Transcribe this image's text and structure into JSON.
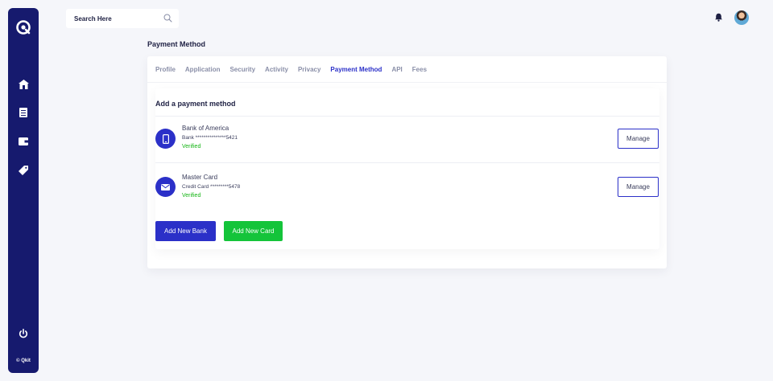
{
  "sidebar": {
    "logo": "qkit-logo-icon",
    "items": [
      {
        "icon": "home-icon"
      },
      {
        "icon": "list-icon"
      },
      {
        "icon": "wallet-icon"
      },
      {
        "icon": "tag-icon"
      }
    ],
    "power_icon": "power-icon",
    "copyright": "© Qkit"
  },
  "header": {
    "search_placeholder": "Search Here",
    "search_icon": "search-icon",
    "bell_icon": "bell-icon"
  },
  "page": {
    "title": "Payment Method",
    "tabs": [
      {
        "label": "Profile",
        "active": false
      },
      {
        "label": "Application",
        "active": false
      },
      {
        "label": "Security",
        "active": false
      },
      {
        "label": "Activity",
        "active": false
      },
      {
        "label": "Privacy",
        "active": false
      },
      {
        "label": "Payment Method",
        "active": true
      },
      {
        "label": "API",
        "active": false
      },
      {
        "label": "Fees",
        "active": false
      }
    ]
  },
  "payment": {
    "section_title": "Add a payment method",
    "methods": [
      {
        "icon": "phone-icon",
        "name": "Bank of America",
        "number": "Bank ***************5421",
        "status": "Verified",
        "action": "Manage"
      },
      {
        "icon": "envelope-icon",
        "name": "Master Card",
        "number": "Credit Card *********5478",
        "status": "Verified",
        "action": "Manage"
      }
    ],
    "add_bank_label": "Add New Bank",
    "add_card_label": "Add New Card"
  },
  "colors": {
    "sidebar": "#161a6e",
    "accent": "#2b30c8",
    "success": "#14c43a",
    "background": "#f5f6fa"
  }
}
